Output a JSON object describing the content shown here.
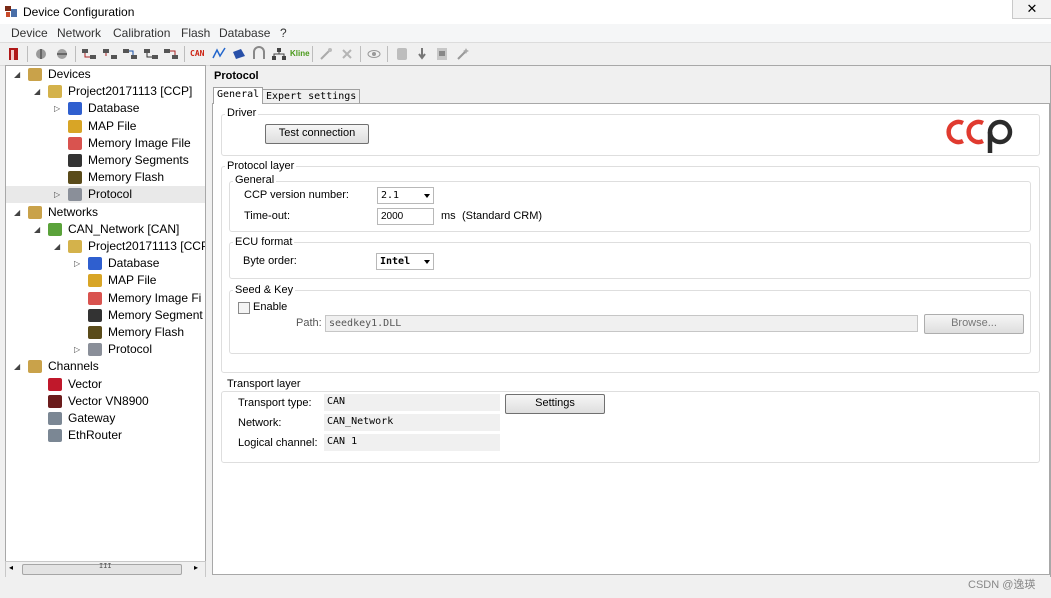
{
  "window": {
    "title": "Device Configuration",
    "close_glyph": "✕"
  },
  "menu": [
    "Device",
    "Network",
    "Calibration",
    "Flash",
    "Database",
    "?"
  ],
  "toolbar_icons": [
    "exit-icon",
    "add-device-icon",
    "remove-device-icon",
    "connect-icon",
    "disconnect-icon",
    "swap-icon",
    "forward-icon",
    "back-icon",
    "can-icon",
    "lin-icon",
    "flexray-icon",
    "ethernet-icon",
    "network-icon",
    "kline-icon",
    "tool-icon",
    "delete-icon",
    "eye-icon",
    "database-icon",
    "down-arrow-icon",
    "pdf-icon",
    "wizard-icon"
  ],
  "toolbar_text": {
    "can": "CAN",
    "kline": "Kline"
  },
  "tree": {
    "nodes": [
      {
        "label": "Devices",
        "icon": "folder-icon",
        "depth": 0,
        "exp": "expanded"
      },
      {
        "label": "Project20171113 [CCP]",
        "icon": "device-icon",
        "depth": 1,
        "exp": "expanded"
      },
      {
        "label": "Database",
        "icon": "database-icon",
        "depth": 2,
        "exp": "collapsed"
      },
      {
        "label": "MAP File",
        "icon": "map-file-icon",
        "depth": 2,
        "exp": ""
      },
      {
        "label": "Memory Image File",
        "icon": "memory-image-icon",
        "depth": 2,
        "exp": ""
      },
      {
        "label": "Memory Segments",
        "icon": "memory-segments-icon",
        "depth": 2,
        "exp": ""
      },
      {
        "label": "Memory Flash",
        "icon": "memory-flash-icon",
        "depth": 2,
        "exp": ""
      },
      {
        "label": "Protocol",
        "icon": "protocol-icon",
        "depth": 2,
        "exp": "collapsed"
      },
      {
        "label": "Networks",
        "icon": "networks-folder-icon",
        "depth": 0,
        "exp": "expanded"
      },
      {
        "label": "CAN_Network [CAN]",
        "icon": "can-network-icon",
        "depth": 1,
        "exp": "expanded"
      },
      {
        "label": "Project20171113 [CCP",
        "icon": "device-icon",
        "depth": 2,
        "exp": "expanded"
      },
      {
        "label": "Database",
        "icon": "database-icon",
        "depth": 3,
        "exp": "collapsed"
      },
      {
        "label": "MAP File",
        "icon": "map-file-icon",
        "depth": 3,
        "exp": ""
      },
      {
        "label": "Memory Image Fi",
        "icon": "memory-image-icon",
        "depth": 3,
        "exp": ""
      },
      {
        "label": "Memory Segment",
        "icon": "memory-segments-icon",
        "depth": 3,
        "exp": ""
      },
      {
        "label": "Memory Flash",
        "icon": "memory-flash-icon",
        "depth": 3,
        "exp": ""
      },
      {
        "label": "Protocol",
        "icon": "protocol-icon",
        "depth": 3,
        "exp": "collapsed"
      },
      {
        "label": "Channels",
        "icon": "channels-folder-icon",
        "depth": 0,
        "exp": "expanded"
      },
      {
        "label": "Vector",
        "icon": "vector-icon",
        "depth": 1,
        "exp": ""
      },
      {
        "label": "Vector VN8900",
        "icon": "vn8900-icon",
        "depth": 1,
        "exp": ""
      },
      {
        "label": "Gateway",
        "icon": "gateway-icon",
        "depth": 1,
        "exp": ""
      },
      {
        "label": "EthRouter",
        "icon": "ethrouter-icon",
        "depth": 1,
        "exp": ""
      }
    ],
    "selected": "Protocol",
    "scroll_glyph": "III"
  },
  "panel": {
    "title": "Protocol",
    "tabs": [
      "General",
      "Expert settings"
    ],
    "active_tab": "General",
    "driver": {
      "label": "Driver",
      "test_button": "Test connection",
      "logo": "ccp"
    },
    "protocol_layer": {
      "label": "Protocol layer",
      "general": {
        "label": "General",
        "ccp_version_label": "CCP version number:",
        "ccp_version_value": "2.1",
        "timeout_label": "Time-out:",
        "timeout_value": "2000",
        "timeout_unit": "ms",
        "timeout_note": "(Standard CRM)"
      },
      "ecu_format": {
        "label": "ECU format",
        "byte_order_label": "Byte order:",
        "byte_order_value": "Intel"
      },
      "seed_key": {
        "label": "Seed & Key",
        "enable_label": "Enable",
        "enabled": false,
        "path_label": "Path:",
        "path_value": "seedkey1.DLL",
        "browse_label": "Browse..."
      }
    },
    "transport_layer": {
      "label": "Transport layer",
      "type_label": "Transport type:",
      "type_value": "CAN",
      "settings_button": "Settings",
      "network_label": "Network:",
      "network_value": "CAN_Network",
      "channel_label": "Logical channel:",
      "channel_value": "CAN 1"
    }
  },
  "watermark": "CSDN @逸瑛",
  "colors": {
    "ccp_red": "#e03a2f",
    "ccp_dark": "#2b2b2b",
    "selection": "#e9e9e9"
  }
}
